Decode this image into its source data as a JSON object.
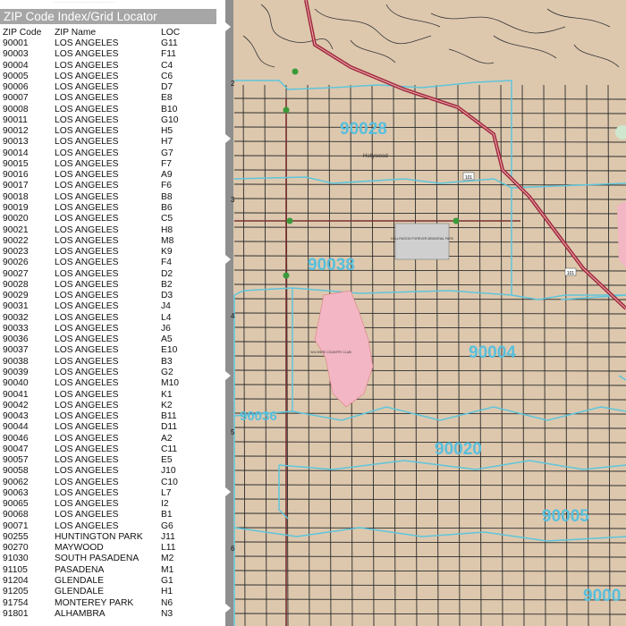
{
  "index": {
    "title": "ZIP Code Index/Grid Locator",
    "columns": [
      "ZIP Code",
      "ZIP Name",
      "LOC"
    ],
    "rows": [
      [
        "90001",
        "LOS ANGELES",
        "G11"
      ],
      [
        "90003",
        "LOS ANGELES",
        "F11"
      ],
      [
        "90004",
        "LOS ANGELES",
        "C4"
      ],
      [
        "90005",
        "LOS ANGELES",
        "C6"
      ],
      [
        "90006",
        "LOS ANGELES",
        "D7"
      ],
      [
        "90007",
        "LOS ANGELES",
        "E8"
      ],
      [
        "90008",
        "LOS ANGELES",
        "B10"
      ],
      [
        "90011",
        "LOS ANGELES",
        "G10"
      ],
      [
        "90012",
        "LOS ANGELES",
        "H5"
      ],
      [
        "90013",
        "LOS ANGELES",
        "H7"
      ],
      [
        "90014",
        "LOS ANGELES",
        "G7"
      ],
      [
        "90015",
        "LOS ANGELES",
        "F7"
      ],
      [
        "90016",
        "LOS ANGELES",
        "A9"
      ],
      [
        "90017",
        "LOS ANGELES",
        "F6"
      ],
      [
        "90018",
        "LOS ANGELES",
        "B8"
      ],
      [
        "90019",
        "LOS ANGELES",
        "B6"
      ],
      [
        "90020",
        "LOS ANGELES",
        "C5"
      ],
      [
        "90021",
        "LOS ANGELES",
        "H8"
      ],
      [
        "90022",
        "LOS ANGELES",
        "M8"
      ],
      [
        "90023",
        "LOS ANGELES",
        "K9"
      ],
      [
        "90026",
        "LOS ANGELES",
        "F4"
      ],
      [
        "90027",
        "LOS ANGELES",
        "D2"
      ],
      [
        "90028",
        "LOS ANGELES",
        "B2"
      ],
      [
        "90029",
        "LOS ANGELES",
        "D3"
      ],
      [
        "90031",
        "LOS ANGELES",
        "J4"
      ],
      [
        "90032",
        "LOS ANGELES",
        "L4"
      ],
      [
        "90033",
        "LOS ANGELES",
        "J6"
      ],
      [
        "90036",
        "LOS ANGELES",
        "A5"
      ],
      [
        "90037",
        "LOS ANGELES",
        "E10"
      ],
      [
        "90038",
        "LOS ANGELES",
        "B3"
      ],
      [
        "90039",
        "LOS ANGELES",
        "G2"
      ],
      [
        "90040",
        "LOS ANGELES",
        "M10"
      ],
      [
        "90041",
        "LOS ANGELES",
        "K1"
      ],
      [
        "90042",
        "LOS ANGELES",
        "K2"
      ],
      [
        "90043",
        "LOS ANGELES",
        "B11"
      ],
      [
        "90044",
        "LOS ANGELES",
        "D11"
      ],
      [
        "90046",
        "LOS ANGELES",
        "A2"
      ],
      [
        "90047",
        "LOS ANGELES",
        "C11"
      ],
      [
        "90057",
        "LOS ANGELES",
        "E5"
      ],
      [
        "90058",
        "LOS ANGELES",
        "J10"
      ],
      [
        "90062",
        "LOS ANGELES",
        "C10"
      ],
      [
        "90063",
        "LOS ANGELES",
        "L7"
      ],
      [
        "90065",
        "LOS ANGELES",
        "I2"
      ],
      [
        "90068",
        "LOS ANGELES",
        "B1"
      ],
      [
        "90071",
        "LOS ANGELES",
        "G6"
      ],
      [
        "90255",
        "HUNTINGTON PARK",
        "J11"
      ],
      [
        "90270",
        "MAYWOOD",
        "L11"
      ],
      [
        "91030",
        "SOUTH PASADENA",
        "M2"
      ],
      [
        "91105",
        "PASADENA",
        "M1"
      ],
      [
        "91204",
        "GLENDALE",
        "G1"
      ],
      [
        "91205",
        "GLENDALE",
        "H1"
      ],
      [
        "91754",
        "MONTEREY PARK",
        "N6"
      ],
      [
        "91801",
        "ALHAMBRA",
        "N3"
      ]
    ]
  },
  "map": {
    "zip_labels": [
      "90028",
      "90038",
      "90004",
      "90036",
      "90020",
      "90005",
      "9000"
    ],
    "grid_rows": [
      "2",
      "3",
      "4",
      "5",
      "6"
    ],
    "place_labels": [
      "Hollywood",
      "HOLLYWOOD FOREVER MEMORIAL PARK",
      "WILSHIRE COUNTRY CLUB"
    ],
    "highway_shields": [
      "101",
      "101"
    ],
    "colors": {
      "land": "#ddc8ae",
      "zip_boundary": "#5ec5db",
      "zip_label": "#58bfdd",
      "freeway": "#a0283a",
      "park": "#f3b6c4",
      "street": "#2a2a2a",
      "ruler": "#8f8f8f"
    }
  }
}
